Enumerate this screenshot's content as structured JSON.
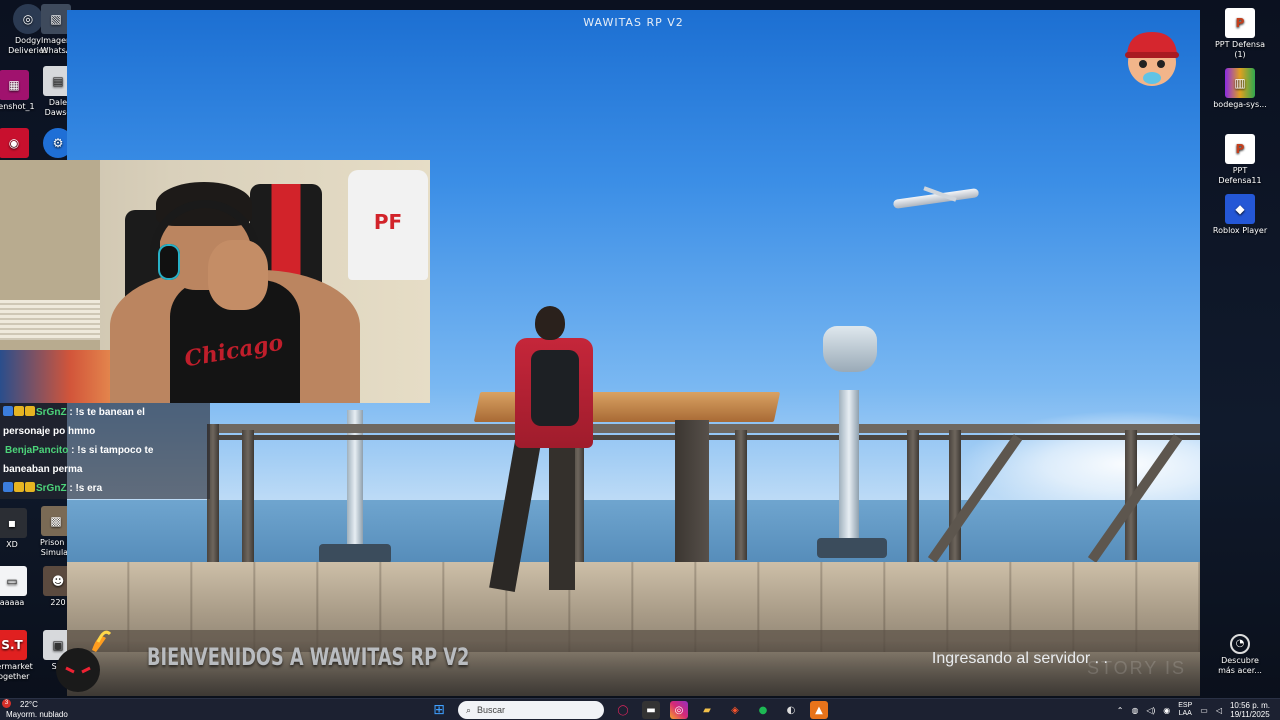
{
  "game": {
    "window_title": "WAWITAS RP V2",
    "welcome_text": "BIENVENIDOS A WAWITAS RP V2",
    "loading_text": "Ingresando al servidor . .",
    "watermark_text": "STORY IS"
  },
  "chat": {
    "messages": [
      {
        "user": "SrGnZ",
        "text": ": !s te banean el",
        "text2": "personaje po hmno"
      },
      {
        "user": "BenjaPancito",
        "text": ": !s si tampoco te",
        "text2": "baneaban perma"
      },
      {
        "user": "SrGnZ",
        "text": ": !s era"
      }
    ]
  },
  "webcam": {
    "jersey_label": "PF",
    "tank_label": "Chicago"
  },
  "desktop_left": [
    {
      "label": "Dodgy\nDeliveries",
      "icon": "game-icon"
    },
    {
      "label": "Imagen\nWhatsA",
      "icon": "image-icon"
    },
    {
      "label": "eenshot_1",
      "icon": "screenshot-icon"
    },
    {
      "label": "Dale\nDawso",
      "icon": "document-icon"
    },
    {
      "label": "",
      "icon": "among-us-icon"
    },
    {
      "label": "",
      "icon": "settings-icon"
    },
    {
      "label": "XD",
      "icon": "folder-icon"
    },
    {
      "label": "Prison E\nSimulat",
      "icon": "game-icon"
    },
    {
      "label": "aaaaa",
      "icon": "file-icon"
    },
    {
      "label": "220",
      "icon": "image-icon"
    },
    {
      "label": "permarket\nTogether",
      "icon": "supermarket-icon"
    },
    {
      "label": "Scr",
      "icon": "screenshot-icon"
    }
  ],
  "desktop_right": [
    {
      "label": "PPT Defensa\n(1)",
      "icon": "powerpoint-icon"
    },
    {
      "label": "bodega-sys...",
      "icon": "winrar-icon"
    },
    {
      "label": "PPT\nDefensa11",
      "icon": "powerpoint-icon"
    },
    {
      "label": "Roblox Player",
      "icon": "roblox-icon"
    },
    {
      "label": "Descubre\nmás acer...",
      "icon": "discover-icon"
    }
  ],
  "taskbar": {
    "temperature": "22°C",
    "weather": "Mayorm. nublado",
    "search_placeholder": "Buscar",
    "lang": "ESP",
    "lang2": "LAA",
    "time": "10:56 p. m.",
    "date": "19/11/2025",
    "notif_count": "3"
  },
  "colors": {
    "username_green": "#4cd47a",
    "taskbar_bg": "#1c2131",
    "sky_top": "#1c6fd2"
  }
}
